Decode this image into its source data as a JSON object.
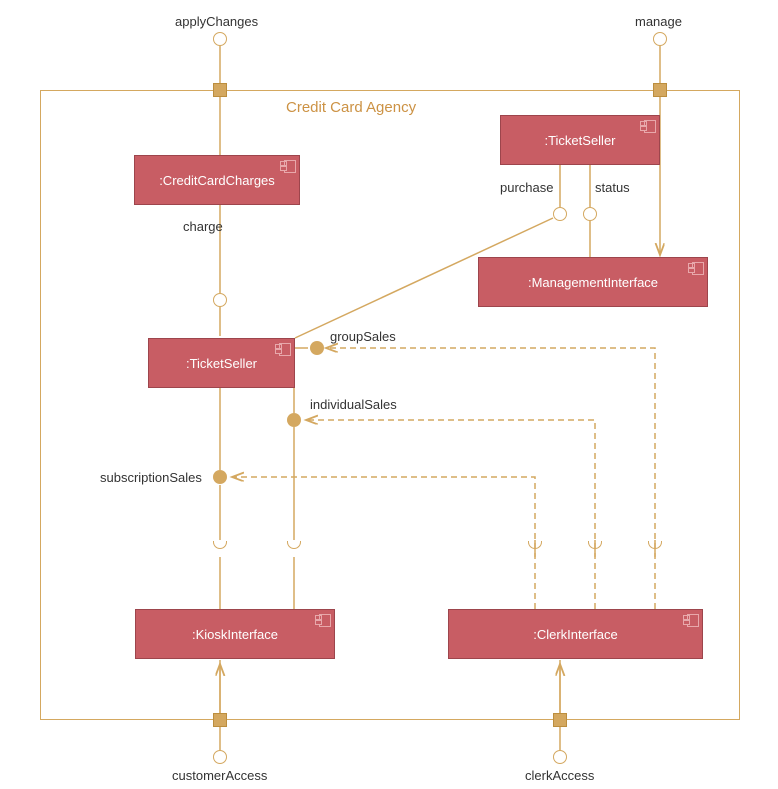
{
  "diagram": {
    "title": "Credit Card Agency",
    "components": {
      "creditCardCharges": ":CreditCardCharges",
      "ticketSellerTop": ":TicketSeller",
      "ticketSellerMid": ":TicketSeller",
      "managementInterface": ":ManagementInterface",
      "kioskInterface": ":KioskInterface",
      "clerkInterface": ":ClerkInterface"
    },
    "labels": {
      "applyChanges": "applyChanges",
      "manage": "manage",
      "charge": "charge",
      "purchase": "purchase",
      "status": "status",
      "groupSales": "groupSales",
      "individualSales": "individualSales",
      "subscriptionSales": "subscriptionSales",
      "customerAccess": "customerAccess",
      "clerkAccess": "clerkAccess"
    }
  }
}
